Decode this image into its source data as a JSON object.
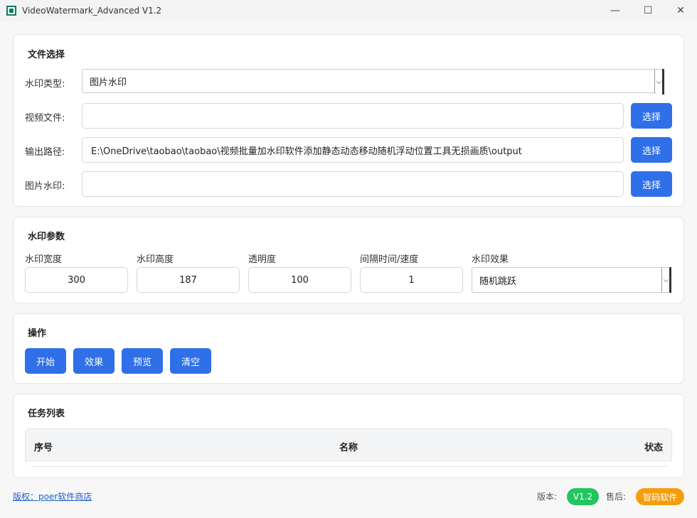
{
  "window": {
    "title": "VideoWatermark_Advanced V1.2",
    "minimize_glyph": "—",
    "maximize_glyph": "☐",
    "close_glyph": "✕"
  },
  "file_section": {
    "title": "文件选择",
    "watermark_type_label": "水印类型:",
    "watermark_type_value": "图片水印",
    "video_file_label": "视频文件:",
    "video_file_value": "",
    "output_path_label": "输出路径:",
    "output_path_value": "E:\\OneDrive\\taobao\\taobao\\视频批量加水印软件添加静态动态移动随机浮动位置工具无损画质\\output",
    "image_watermark_label": "图片水印:",
    "image_watermark_value": "",
    "choose_label": "选择"
  },
  "params_section": {
    "title": "水印参数",
    "width_label": "水印宽度",
    "width_value": "300",
    "height_label": "水印高度",
    "height_value": "187",
    "opacity_label": "透明度",
    "opacity_value": "100",
    "interval_label": "间隔时间/速度",
    "interval_value": "1",
    "effect_label": "水印效果",
    "effect_value": "随机跳跃"
  },
  "actions_section": {
    "title": "操作",
    "start_label": "开始",
    "effect_label": "效果",
    "preview_label": "预览",
    "clear_label": "清空"
  },
  "tasks_section": {
    "title": "任务列表",
    "columns": [
      "序号",
      "名称",
      "状态"
    ]
  },
  "footer": {
    "copyright": "版权：poer软件商店",
    "version_label": "版本:",
    "version_value": "V1.2",
    "support_label": "售后:",
    "support_value": "智码软件"
  },
  "colors": {
    "primary_button": "#2f6fe8",
    "version_pill": "#22c55e",
    "support_pill": "#f59e0b",
    "link": "#1f5fbf"
  },
  "icons": {
    "app": "app-icon",
    "dropdown": "chevron-down-icon"
  }
}
